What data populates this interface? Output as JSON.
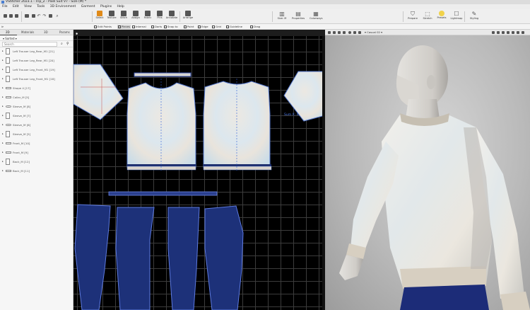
{
  "window": {
    "title": "VStitcher 2023.1 - Trip_2 - Pixel Suit V7 - Size (M) *"
  },
  "menu": [
    "File",
    "Edit",
    "View",
    "Tools",
    "3D Environment",
    "Garment",
    "Plugins",
    "Help"
  ],
  "toolbar": {
    "left_tools": [
      "Select",
      "Texture",
      "Stitch",
      "Assign",
      "Fabric",
      "Pins",
      "Annotate",
      "Arrange"
    ],
    "mid_tools": [
      "Size: M",
      "Properties",
      "Colorways"
    ],
    "right_tools": [
      "Prepare",
      "Stretch",
      "Presets",
      "Lightmap",
      "Styling"
    ]
  },
  "subtoolbar": [
    "Edit Points",
    "Pieces",
    "Internal",
    "Darts",
    "Snap to",
    "Point",
    "Edge",
    "Grid",
    "Guideline",
    "Drag"
  ],
  "left_panel": {
    "tabs": [
      "2D",
      "Materials",
      "3D",
      "Params"
    ],
    "dropdown": "Sorted",
    "search_placeholder": "Search",
    "items": [
      "Left Trouser Leg_Rear_M1 [21]",
      "Left Trouser Leg_Rear_M1 [20]",
      "Left Trouser Leg_Front_M1 [19]",
      "Left Trouser Leg_Front_M1 [18]",
      "Shape 4 [17]",
      "Collar_M [5]",
      "Sleeve_M [8]",
      "Sleeve_M [7]",
      "Sleeve_M [6]",
      "Sleeve_M [5]",
      "Front_M [10]",
      "Front_M [9]",
      "Back_M [12]",
      "Back_M [11]"
    ]
  },
  "canvas2d": {
    "measurement_label": "Sum X: 4"
  },
  "view3d": {
    "avatar_select": "Casual 02"
  },
  "colors": {
    "piece_top_fill": "#e7ecee",
    "piece_top_tint": "#c5dce8",
    "trouser_fill": "#1d3179",
    "trouser_edge": "#5d7ae0",
    "band": "#2a3f8d",
    "grid": "#3c3c3c",
    "accent": "#e08a19"
  }
}
